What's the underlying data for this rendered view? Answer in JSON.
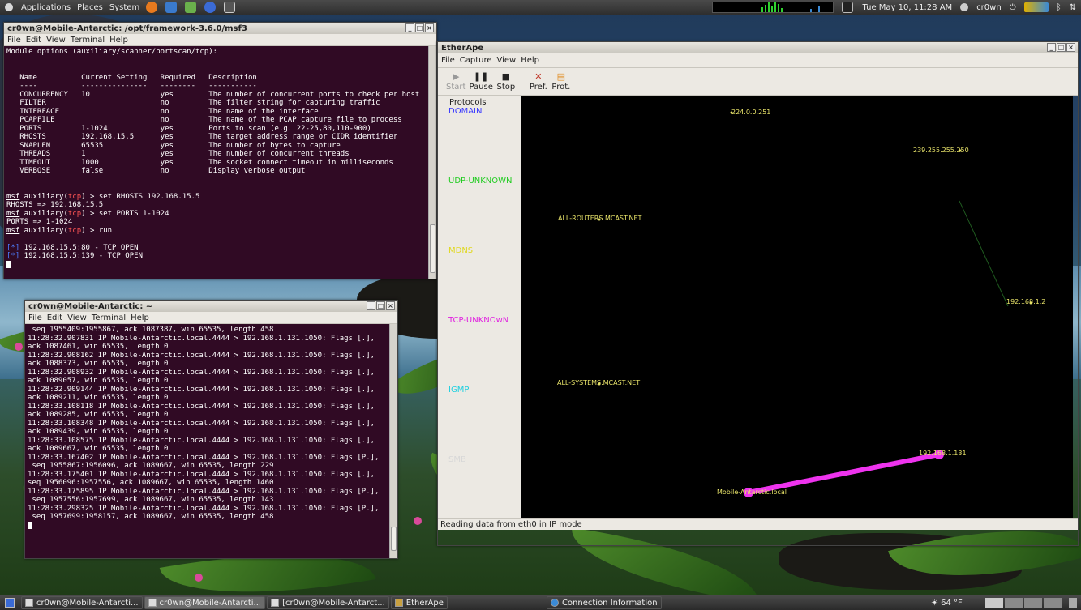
{
  "top_panel": {
    "menus": [
      "Applications",
      "Places",
      "System"
    ],
    "clock": "Tue May 10, 11:28 AM",
    "user": "cr0wn"
  },
  "terminal1": {
    "title": "cr0wn@Mobile-Antarctic: /opt/framework-3.6.0/msf3",
    "menu": [
      "File",
      "Edit",
      "View",
      "Terminal",
      "Help"
    ],
    "header": "Module options (auxiliary/scanner/portscan/tcp):",
    "columns": [
      "Name",
      "Current Setting",
      "Required",
      "Description"
    ],
    "dashes": [
      "----",
      "---------------",
      "--------",
      "-----------"
    ],
    "rows": [
      [
        "CONCURRENCY",
        "10",
        "yes",
        "The number of concurrent ports to check per host"
      ],
      [
        "FILTER",
        "",
        "no",
        "The filter string for capturing traffic"
      ],
      [
        "INTERFACE",
        "",
        "no",
        "The name of the interface"
      ],
      [
        "PCAPFILE",
        "",
        "no",
        "The name of the PCAP capture file to process"
      ],
      [
        "PORTS",
        "1-1024",
        "yes",
        "Ports to scan (e.g. 22-25,80,110-900)"
      ],
      [
        "RHOSTS",
        "192.168.15.5",
        "yes",
        "The target address range or CIDR identifier"
      ],
      [
        "SNAPLEN",
        "65535",
        "yes",
        "The number of bytes to capture"
      ],
      [
        "THREADS",
        "1",
        "yes",
        "The number of concurrent threads"
      ],
      [
        "TIMEOUT",
        "1000",
        "yes",
        "The socket connect timeout in milliseconds"
      ],
      [
        "VERBOSE",
        "false",
        "no",
        "Display verbose output"
      ]
    ],
    "cmd1": " > set RHOSTS 192.168.15.5",
    "out1": "RHOSTS => 192.168.15.5",
    "cmd2": " > set PORTS 1-1024",
    "out2": "PORTS => 1-1024",
    "cmd3": " > run",
    "res1": " 192.168.15.5:80 - TCP OPEN",
    "res2": " 192.168.15.5:139 - TCP OPEN",
    "prompt_msf": "msf",
    "prompt_aux": " auxiliary(",
    "prompt_tcp": "tcp",
    "prompt_close": ")",
    "star": "[*]"
  },
  "terminal2": {
    "title": "cr0wn@Mobile-Antarctic: ~",
    "menu": [
      "File",
      "Edit",
      "View",
      "Terminal",
      "Help"
    ],
    "lines": [
      " seq 1955409:1955867, ack 1087387, win 65535, length 458",
      "11:28:32.907831 IP Mobile-Antarctic.local.4444 > 192.168.1.131.1050: Flags [.],",
      "ack 1087461, win 65535, length 0",
      "11:28:32.908162 IP Mobile-Antarctic.local.4444 > 192.168.1.131.1050: Flags [.],",
      "ack 1088373, win 65535, length 0",
      "11:28:32.908932 IP Mobile-Antarctic.local.4444 > 192.168.1.131.1050: Flags [.],",
      "ack 1089057, win 65535, length 0",
      "11:28:32.909144 IP Mobile-Antarctic.local.4444 > 192.168.1.131.1050: Flags [.],",
      "ack 1089211, win 65535, length 0",
      "11:28:33.108118 IP Mobile-Antarctic.local.4444 > 192.168.1.131.1050: Flags [.],",
      "ack 1089285, win 65535, length 0",
      "11:28:33.108348 IP Mobile-Antarctic.local.4444 > 192.168.1.131.1050: Flags [.],",
      "ack 1089439, win 65535, length 0",
      "11:28:33.108575 IP Mobile-Antarctic.local.4444 > 192.168.1.131.1050: Flags [.],",
      "ack 1089667, win 65535, length 0",
      "11:28:33.167402 IP Mobile-Antarctic.local.4444 > 192.168.1.131.1050: Flags [P.],",
      " seq 1955867:1956096, ack 1089667, win 65535, length 229",
      "11:28:33.175401 IP Mobile-Antarctic.local.4444 > 192.168.1.131.1050: Flags [.],",
      "seq 1956096:1957556, ack 1089667, win 65535, length 1460",
      "11:28:33.175895 IP Mobile-Antarctic.local.4444 > 192.168.1.131.1050: Flags [P.],",
      " seq 1957556:1957699, ack 1089667, win 65535, length 143",
      "11:28:33.298325 IP Mobile-Antarctic.local.4444 > 192.168.1.131.1050: Flags [P.],",
      " seq 1957699:1958157, ack 1089667, win 65535, length 458"
    ]
  },
  "etherape": {
    "title": "EtherApe",
    "menu": [
      "File",
      "Capture",
      "View",
      "Help"
    ],
    "tools": {
      "start": "Start",
      "pause": "Pause",
      "stop": "Stop",
      "pref": "Pref.",
      "prot": "Prot."
    },
    "protocols_label": "Protocols",
    "protocols": [
      {
        "name": "DOMAIN",
        "color": "#3a3aff"
      },
      {
        "name": "UDP-UNKNOWN",
        "color": "#22cc22"
      },
      {
        "name": "MDNS",
        "color": "#e0d820"
      },
      {
        "name": "TCP-UNKNOwN",
        "color": "#e020e0"
      },
      {
        "name": "IGMP",
        "color": "#20d0e0"
      },
      {
        "name": "SMB",
        "color": "#d8d8d8"
      }
    ],
    "nodes": {
      "n1": "224.0.0.251",
      "n2": "239.255.255.250",
      "n3": "ALL-ROUTERS.MCAST.NET",
      "n4": "192.168.1.2",
      "n5": "ALL-SYSTEMS.MCAST.NET",
      "n6": "192.168.1.131",
      "n7": "Mobile-Antarctic.local"
    },
    "status": "Reading data from eth0 in IP mode"
  },
  "taskbar": {
    "tasks": [
      "cr0wn@Mobile-Antarcti...",
      "cr0wn@Mobile-Antarcti...",
      "[cr0wn@Mobile-Antarct...",
      "EtherApe",
      "Connection Information"
    ],
    "weather": "64 °F"
  }
}
